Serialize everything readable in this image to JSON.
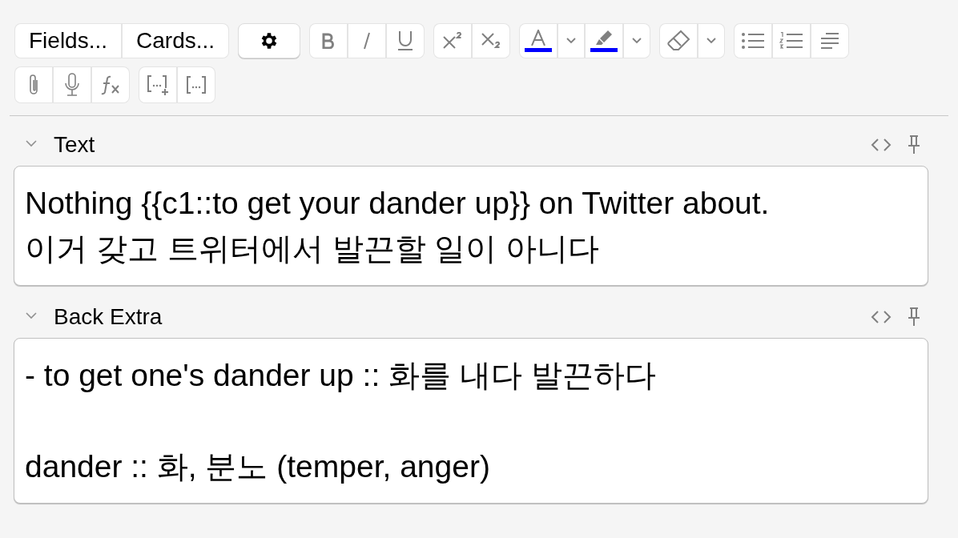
{
  "toolbar": {
    "buttons": [
      {
        "label": "Fields..."
      },
      {
        "label": "Cards..."
      }
    ],
    "color_buttons": [
      {
        "color": "#0000ff"
      },
      {
        "color": "#0000ff"
      }
    ]
  },
  "fields": [
    {
      "name": "Text",
      "expanded": true,
      "paragraphs": [
        [
          "Nothing {{c1::to get your dander up}} on Twitter about.",
          "이거 갖고 트위터에서 발끈할 일이 아니다"
        ]
      ]
    },
    {
      "name": "Back Extra",
      "expanded": true,
      "paragraphs": [
        [
          "- to get one's dander up :: 화를 내다 발끈하다"
        ],
        [
          "dander :: 화, 분노 (temper, anger)"
        ]
      ]
    }
  ]
}
